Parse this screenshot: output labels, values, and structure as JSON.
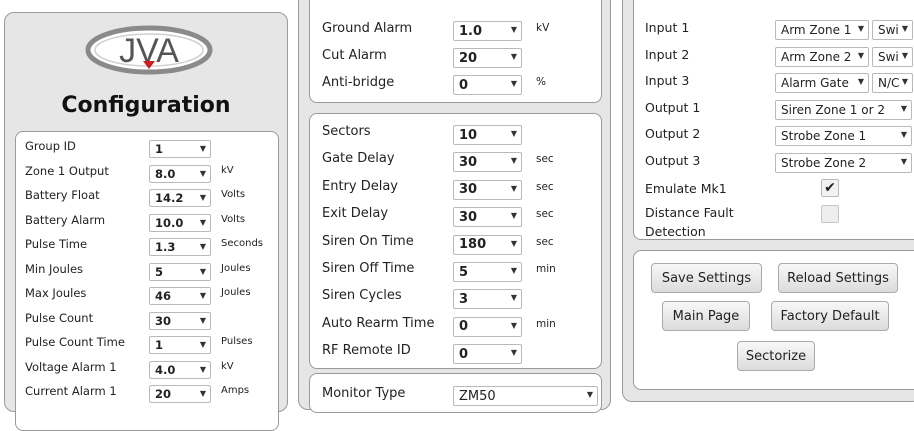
{
  "logo": {
    "text": "JVA"
  },
  "left": {
    "title": "Configuration",
    "rows": [
      {
        "label": "Group ID",
        "value": "1",
        "unit": ""
      },
      {
        "label": "Zone 1 Output",
        "value": "8.0",
        "unit": "kV"
      },
      {
        "label": "Battery Float",
        "value": "14.2",
        "unit": "Volts"
      },
      {
        "label": "Battery Alarm",
        "value": "10.0",
        "unit": "Volts"
      },
      {
        "label": "Pulse Time",
        "value": "1.3",
        "unit": "Seconds"
      },
      {
        "label": "Min Joules",
        "value": "5",
        "unit": "Joules"
      },
      {
        "label": "Max Joules",
        "value": "46",
        "unit": "Joules"
      },
      {
        "label": "Pulse Count",
        "value": "30",
        "unit": ""
      },
      {
        "label": "Pulse Count Time",
        "value": "1",
        "unit": "Pulses"
      },
      {
        "label": "Voltage Alarm 1",
        "value": "4.0",
        "unit": "kV"
      },
      {
        "label": "Current Alarm 1",
        "value": "20",
        "unit": "Amps"
      }
    ]
  },
  "middle": {
    "top": [
      {
        "label": "Ground Alarm",
        "value": "1.0",
        "unit": "kV"
      },
      {
        "label": "Cut Alarm",
        "value": "20",
        "unit": ""
      },
      {
        "label": "Anti-bridge",
        "value": "0",
        "unit": "%"
      }
    ],
    "timing": [
      {
        "label": "Sectors",
        "value": "10",
        "unit": ""
      },
      {
        "label": "Gate Delay",
        "value": "30",
        "unit": "sec"
      },
      {
        "label": "Entry Delay",
        "value": "30",
        "unit": "sec"
      },
      {
        "label": "Exit Delay",
        "value": "30",
        "unit": "sec"
      },
      {
        "label": "Siren On Time",
        "value": "180",
        "unit": "sec"
      },
      {
        "label": "Siren Off Time",
        "value": "5",
        "unit": "min"
      },
      {
        "label": "Siren Cycles",
        "value": "3",
        "unit": ""
      },
      {
        "label": "Auto Rearm Time",
        "value": "0",
        "unit": "min"
      },
      {
        "label": "RF Remote ID",
        "value": "0",
        "unit": ""
      }
    ],
    "monitor": {
      "label": "Monitor Type",
      "value": "ZM50"
    }
  },
  "right": {
    "io": [
      {
        "label": "Input 1",
        "value": "Arm Zone 1",
        "mode": "Swi"
      },
      {
        "label": "Input 2",
        "value": "Arm Zone 2",
        "mode": "Swi"
      },
      {
        "label": "Input 3",
        "value": "Alarm Gate",
        "mode": "N/C"
      },
      {
        "label": "Output 1",
        "value": "Siren Zone 1 or 2",
        "mode": ""
      },
      {
        "label": "Output 2",
        "value": "Strobe Zone 1",
        "mode": ""
      },
      {
        "label": "Output 3",
        "value": "Strobe Zone 2",
        "mode": ""
      }
    ],
    "emulate": {
      "label": "Emulate Mk1",
      "checked": true
    },
    "distance": {
      "label_line1": "Distance Fault",
      "label_line2": "Detection",
      "checked": false
    },
    "buttons": {
      "save": "Save Settings",
      "reload": "Reload Settings",
      "main": "Main Page",
      "factory": "Factory Default",
      "sectorize": "Sectorize"
    }
  }
}
